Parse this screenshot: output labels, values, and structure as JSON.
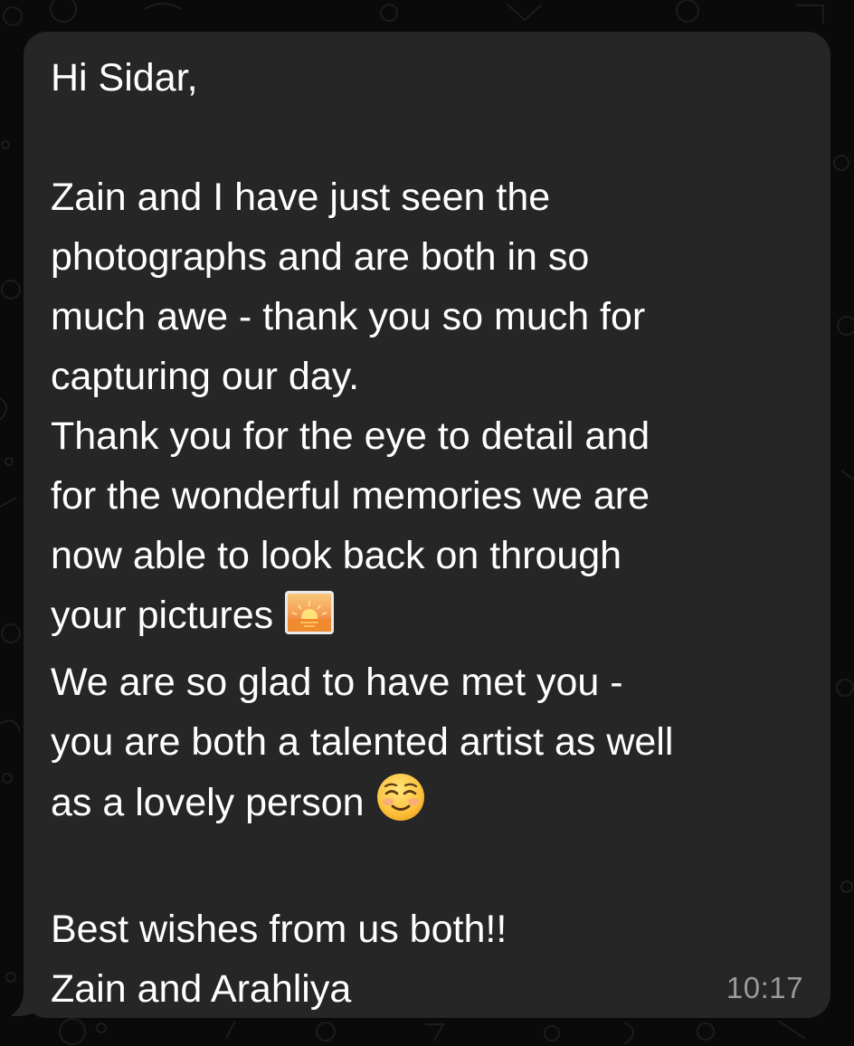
{
  "message": {
    "lines": [
      "Hi Sidar,",
      "",
      "Zain and I have just seen the",
      "photographs and are both in so",
      "much awe - thank you so much for",
      "capturing our day.",
      "Thank you for the eye to detail and",
      "for the wonderful memories we are",
      "now able to look back on through",
      "your pictures ",
      "We are so glad to have met you -",
      "you are both a talented artist as well",
      "as a lovely person ",
      "",
      "Best wishes from us both!!",
      "Zain and Arahliya"
    ],
    "time": "10:17"
  },
  "icons": {
    "sunrise": "sunrise-emoji-icon",
    "smile": "smiling-face-emoji-icon"
  },
  "colors": {
    "bubble": "#262626",
    "background": "#0a0a0a",
    "text": "#ffffff",
    "timestamp": "#9a9a9a"
  }
}
